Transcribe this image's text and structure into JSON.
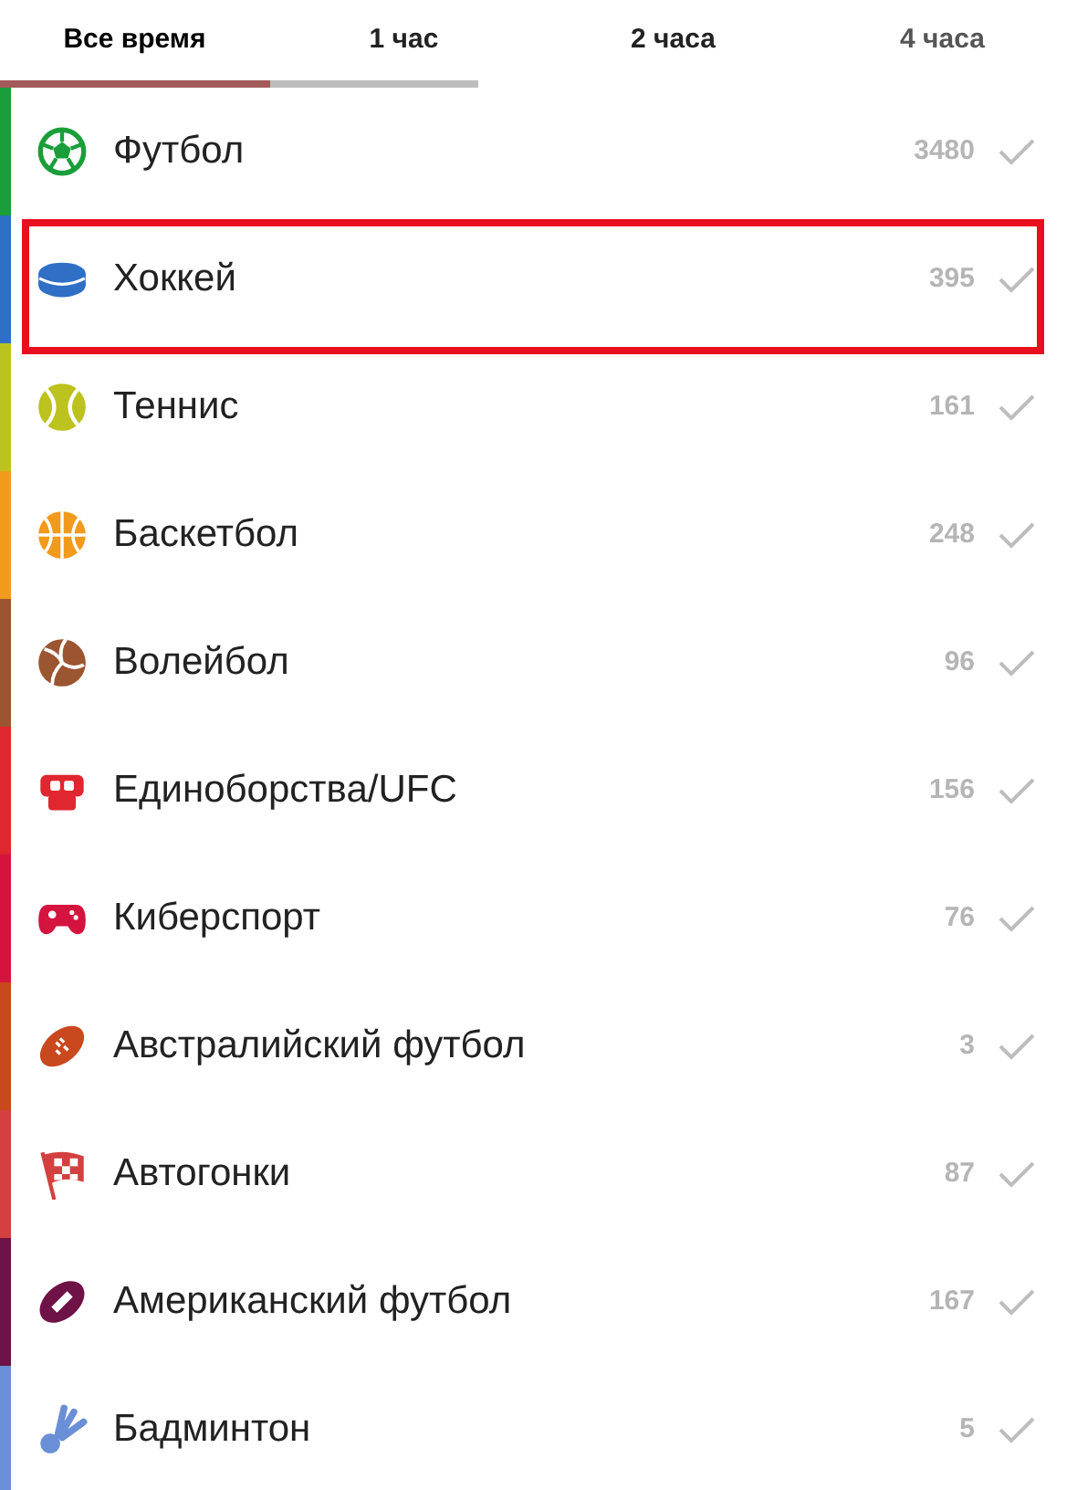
{
  "tabs": [
    {
      "label": "Все время",
      "selected": true
    },
    {
      "label": "1 час",
      "selected": false
    },
    {
      "label": "2 часа",
      "selected": false
    },
    {
      "label": "4 часа",
      "selected": false
    }
  ],
  "sports": [
    {
      "name": "Футбол",
      "count": "3480",
      "color": "#1a9e3a",
      "highlighted": false
    },
    {
      "name": "Хоккей",
      "count": "395",
      "color": "#2f6fc6",
      "highlighted": true
    },
    {
      "name": "Теннис",
      "count": "161",
      "color": "#bcc21e",
      "highlighted": false
    },
    {
      "name": "Баскетбол",
      "count": "248",
      "color": "#f29a1c",
      "highlighted": false
    },
    {
      "name": "Волейбол",
      "count": "96",
      "color": "#9c5531",
      "highlighted": false
    },
    {
      "name": "Единоборства/UFC",
      "count": "156",
      "color": "#e0262f",
      "highlighted": false
    },
    {
      "name": "Киберспорт",
      "count": "76",
      "color": "#d4143f",
      "highlighted": false
    },
    {
      "name": "Австралийский футбол",
      "count": "3",
      "color": "#c9481d",
      "highlighted": false
    },
    {
      "name": "Автогонки",
      "count": "87",
      "color": "#d43f3f",
      "highlighted": false
    },
    {
      "name": "Американский футбол",
      "count": "167",
      "color": "#6e1247",
      "highlighted": false
    },
    {
      "name": "Бадминтон",
      "count": "5",
      "color": "#6a8fd6",
      "highlighted": false
    }
  ]
}
